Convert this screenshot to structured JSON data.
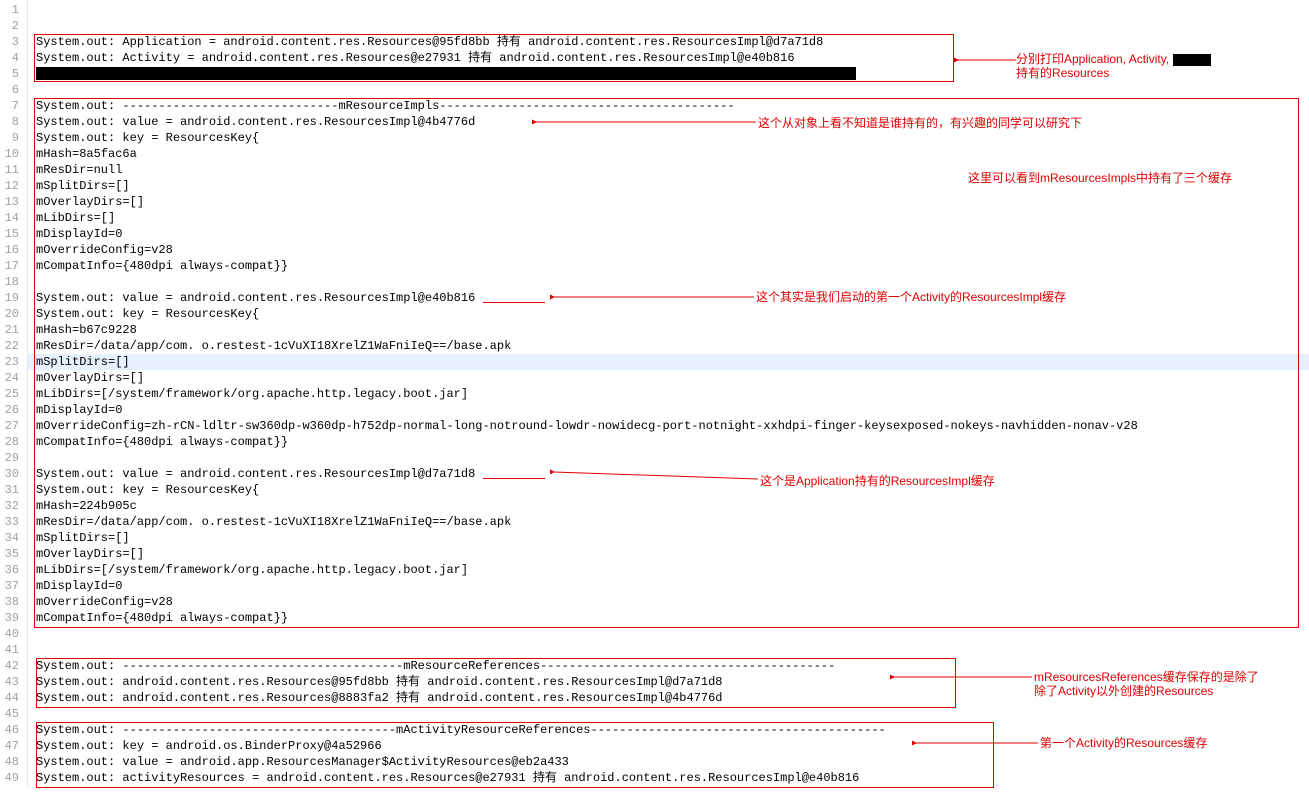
{
  "lines": {
    "l1": "",
    "l2": "",
    "l3": "System.out: Application = android.content.res.Resources@95fd8bb  持有  android.content.res.ResourcesImpl@d7a71d8",
    "l4": "System.out: Activity = android.content.res.Resources@e27931  持有  android.content.res.ResourcesImpl@e40b816",
    "l5_redact_width": "820",
    "l6": "",
    "l7": "System.out: ------------------------------mResourceImpls-----------------------------------------",
    "l8": "System.out: value = android.content.res.ResourcesImpl@4b4776d",
    "l9": "System.out: key = ResourcesKey{",
    "l10": "mHash=8a5fac6a",
    "l11": "mResDir=null",
    "l12": "mSplitDirs=[]",
    "l13": "mOverlayDirs=[]",
    "l14": "mLibDirs=[]",
    "l15": "mDisplayId=0",
    "l16": "mOverrideConfig=v28",
    "l17": "mCompatInfo={480dpi always-compat}}",
    "l18": "",
    "l19": "System.out: value = android.content.res.ResourcesImpl@e40b816",
    "l20": "System.out: key = ResourcesKey{",
    "l21": "mHash=b67c9228",
    "l22": "mResDir=/data/app/com.    o.restest-1cVuXI18XrelZ1WaFniIeQ==/base.apk",
    "l23": "mSplitDirs=[]",
    "l24": "mOverlayDirs=[]",
    "l25": "mLibDirs=[/system/framework/org.apache.http.legacy.boot.jar]",
    "l26": "mDisplayId=0",
    "l27": "mOverrideConfig=zh-rCN-ldltr-sw360dp-w360dp-h752dp-normal-long-notround-lowdr-nowidecg-port-notnight-xxhdpi-finger-keysexposed-nokeys-navhidden-nonav-v28",
    "l28": "mCompatInfo={480dpi always-compat}}",
    "l29": "",
    "l30": "System.out: value = android.content.res.ResourcesImpl@d7a71d8",
    "l31": "System.out: key = ResourcesKey{",
    "l32": "mHash=224b905c",
    "l33": "mResDir=/data/app/com.    o.restest-1cVuXI18XrelZ1WaFniIeQ==/base.apk",
    "l34": "mSplitDirs=[]",
    "l35": "mOverlayDirs=[]",
    "l36": "mLibDirs=[/system/framework/org.apache.http.legacy.boot.jar]",
    "l37": "mDisplayId=0",
    "l38": "mOverrideConfig=v28",
    "l39": "mCompatInfo={480dpi always-compat}}",
    "l40": "",
    "l41": "",
    "l42": "System.out: ---------------------------------------mResourceReferences-----------------------------------------",
    "l43": "System.out: android.content.res.Resources@95fd8bb  持有  android.content.res.ResourcesImpl@d7a71d8",
    "l44": "System.out: android.content.res.Resources@8883fa2  持有  android.content.res.ResourcesImpl@4b4776d",
    "l45": "",
    "l46": "System.out: --------------------------------------mActivityResourceReferences-----------------------------------------",
    "l47": "System.out: key = android.os.BinderProxy@4a52966",
    "l48": "System.out: value = android.app.ResourcesManager$ActivityResources@eb2a433",
    "l49": "System.out: activityResources = android.content.res.Resources@e27931  持有  android.content.res.ResourcesImpl@e40b816"
  },
  "annotations": {
    "a1": "分别打印Application, Activity,",
    "a1b": "持有的Resources",
    "a2": "这个从对象上看不知道是谁持有的，有兴趣的同学可以研究下",
    "a3": "这里可以看到mResourcesImpls中持有了三个缓存",
    "a4": "这个其实是我们启动的第一个Activity的ResourcesImpl缓存",
    "a5": "这个是Application持有的ResourcesImpl缓存",
    "a6": "mResourcesReferences缓存保存的是除了",
    "a6b": "除了Activity以外创建的Resources",
    "a7": "第一个Activity的Resources缓存"
  },
  "line_count": 49
}
